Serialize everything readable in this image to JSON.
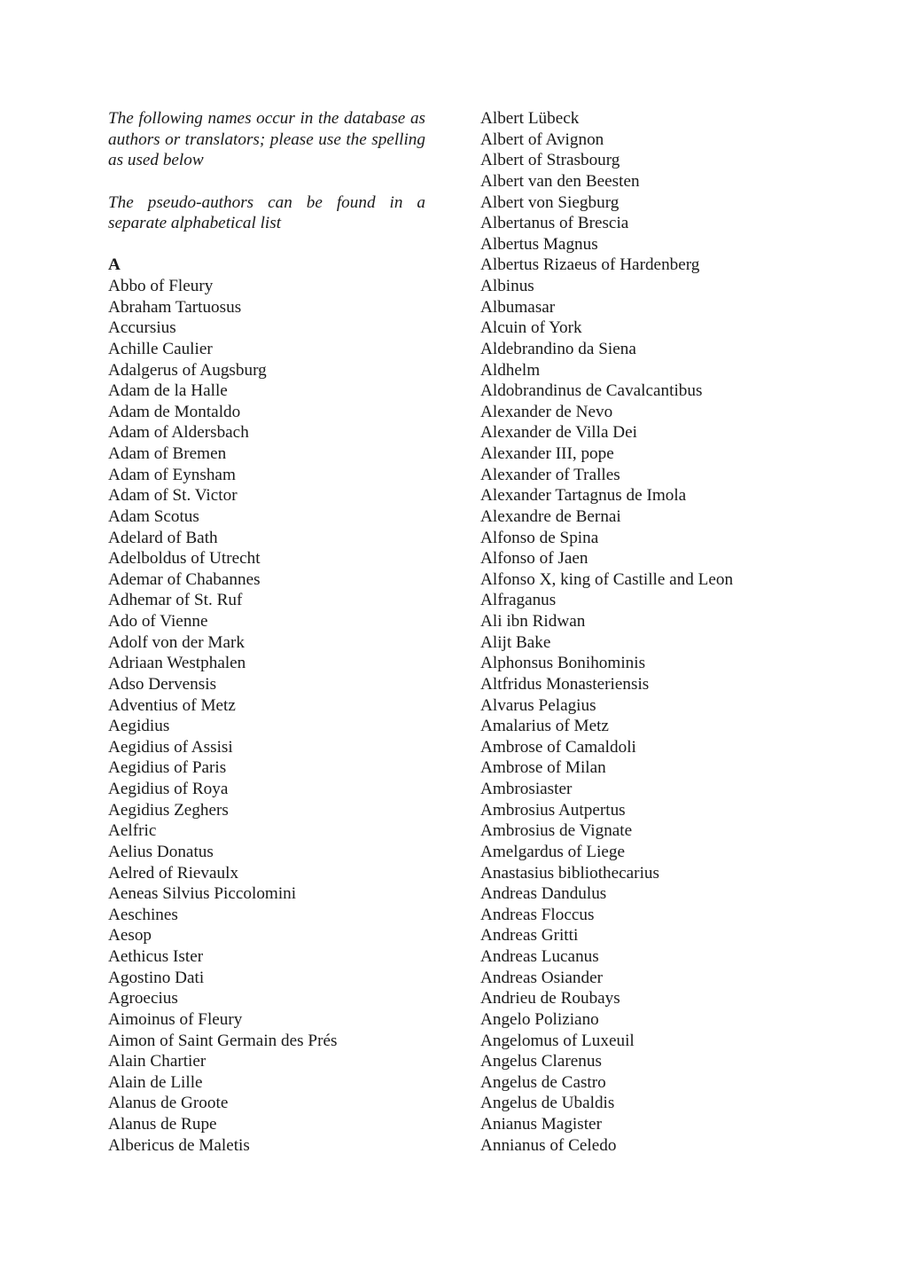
{
  "intro": {
    "paragraph_1": "The following names occur in the database as authors or translators; please use the spelling as used below",
    "paragraph_2": "The pseudo-authors can be found in a separate alphabetical list"
  },
  "section": {
    "letter": "A"
  },
  "left_column": {
    "names": [
      "Abbo of Fleury",
      "Abraham Tartuosus",
      "Accursius",
      "Achille Caulier",
      "Adalgerus of Augsburg",
      "Adam de la Halle",
      "Adam de Montaldo",
      "Adam of Aldersbach",
      "Adam of Bremen",
      "Adam of Eynsham",
      "Adam of St. Victor",
      "Adam Scotus",
      "Adelard of Bath",
      "Adelboldus of Utrecht",
      "Ademar of Chabannes",
      "Adhemar of St. Ruf",
      "Ado of Vienne",
      "Adolf von der Mark",
      "Adriaan Westphalen",
      "Adso Dervensis",
      "Adventius of Metz",
      "Aegidius",
      "Aegidius of Assisi",
      "Aegidius of Paris",
      "Aegidius of Roya",
      "Aegidius Zeghers",
      "Aelfric",
      "Aelius Donatus",
      "Aelred of Rievaulx",
      "Aeneas Silvius Piccolomini",
      "Aeschines",
      "Aesop",
      "Aethicus Ister",
      "Agostino Dati",
      "Agroecius",
      "Aimoinus of Fleury",
      "Aimon of Saint Germain des Prés",
      "Alain Chartier",
      "Alain de Lille",
      "Alanus de Groote",
      "Alanus de Rupe",
      "Albericus de Maletis"
    ]
  },
  "right_column": {
    "names": [
      "Albert Lübeck",
      "Albert of Avignon",
      "Albert of Strasbourg",
      "Albert van den Beesten",
      "Albert von Siegburg",
      "Albertanus of Brescia",
      "Albertus Magnus",
      "Albertus Rizaeus of Hardenberg",
      "Albinus",
      "Albumasar",
      "Alcuin of York",
      "Aldebrandino da Siena",
      "Aldhelm",
      "Aldobrandinus de Cavalcantibus",
      "Alexander de Nevo",
      "Alexander de Villa Dei",
      "Alexander III, pope",
      "Alexander of Tralles",
      "Alexander Tartagnus de Imola",
      "Alexandre de Bernai",
      "Alfonso de Spina",
      "Alfonso of Jaen",
      "Alfonso X, king of Castille and Leon",
      "Alfraganus",
      "Ali ibn Ridwan",
      "Alijt Bake",
      "Alphonsus Bonihominis",
      "Altfridus Monasteriensis",
      "Alvarus Pelagius",
      "Amalarius of Metz",
      "Ambrose of Camaldoli",
      "Ambrose of Milan",
      "Ambrosiaster",
      "Ambrosius Autpertus",
      "Ambrosius de Vignate",
      "Amelgardus of Liege",
      "Anastasius bibliothecarius",
      "Andreas Dandulus",
      "Andreas Floccus",
      "Andreas Gritti",
      "Andreas Lucanus",
      "Andreas Osiander",
      "Andrieu de Roubays",
      "Angelo Poliziano",
      "Angelomus of Luxeuil",
      "Angelus Clarenus",
      "Angelus de Castro",
      "Angelus de Ubaldis",
      "Anianus Magister",
      "Annianus of Celedo"
    ]
  }
}
